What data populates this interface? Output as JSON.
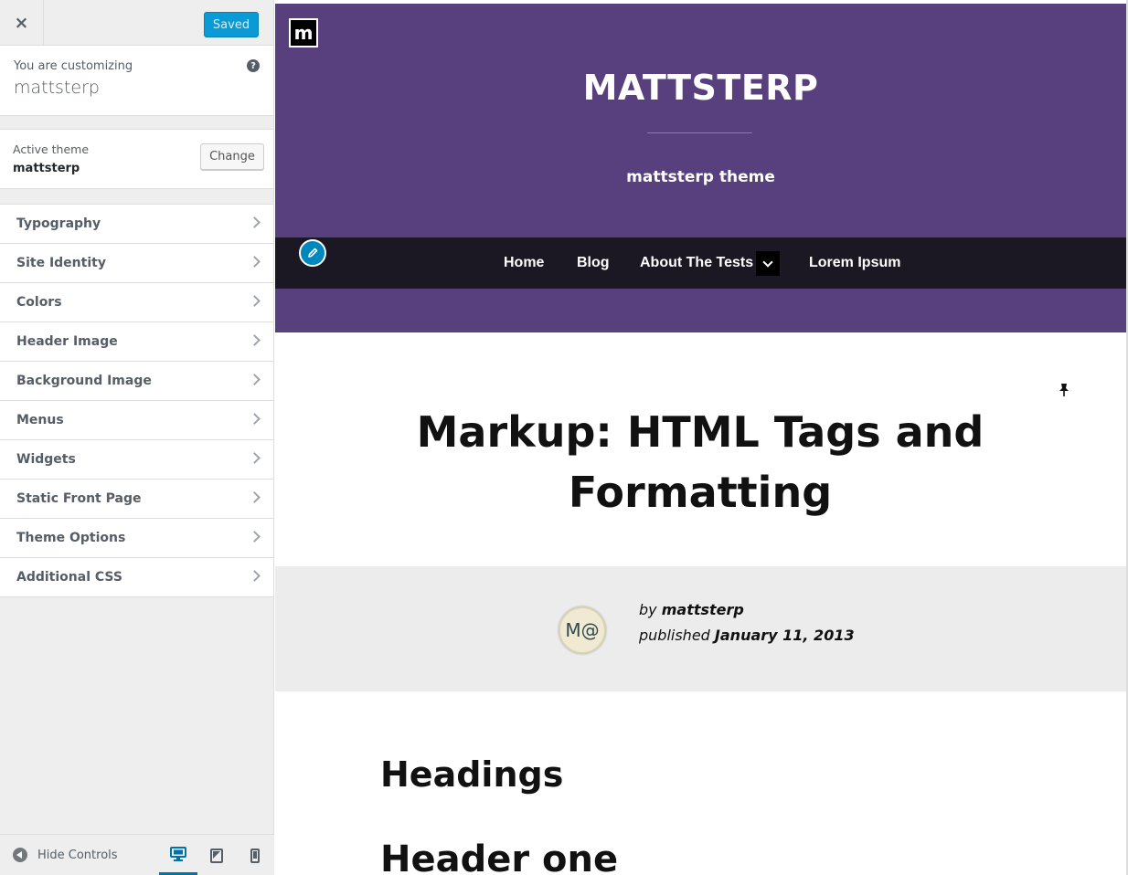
{
  "sidebar": {
    "close_glyph": "×",
    "saved_label": "Saved",
    "customizing_label": "You are customizing",
    "customizing_name": "mattsterp",
    "help_glyph": "?",
    "active_theme_label": "Active theme",
    "active_theme_name": "mattsterp",
    "change_label": "Change",
    "sections": [
      {
        "label": "Typography"
      },
      {
        "label": "Site Identity"
      },
      {
        "label": "Colors"
      },
      {
        "label": "Header Image"
      },
      {
        "label": "Background Image"
      },
      {
        "label": "Menus"
      },
      {
        "label": "Widgets"
      },
      {
        "label": "Static Front Page"
      },
      {
        "label": "Theme Options"
      },
      {
        "label": "Additional CSS"
      }
    ],
    "hide_controls_label": "Hide Controls",
    "devices": [
      "desktop-icon",
      "tablet-icon",
      "mobile-icon"
    ],
    "active_device": "desktop"
  },
  "preview": {
    "logo_letter": "m",
    "site_title": "MATTSTERP",
    "tagline": "mattsterp theme",
    "nav": {
      "home": "Home",
      "blog": "Blog",
      "about": "About The Tests",
      "lorem": "Lorem Ipsum"
    },
    "post_title": "Markup: HTML Tags and Formatting",
    "avatar_text": "M@",
    "by_prefix": "by",
    "author": "mattsterp",
    "published_prefix": "published",
    "date": "January 11, 2013",
    "heading": "Headings",
    "subheading": "Header one"
  },
  "colors": {
    "header_bg": "#583f7e",
    "nav_bg": "#1b1823",
    "accent": "#0073aa",
    "saved_button": "#0a9ad6"
  }
}
